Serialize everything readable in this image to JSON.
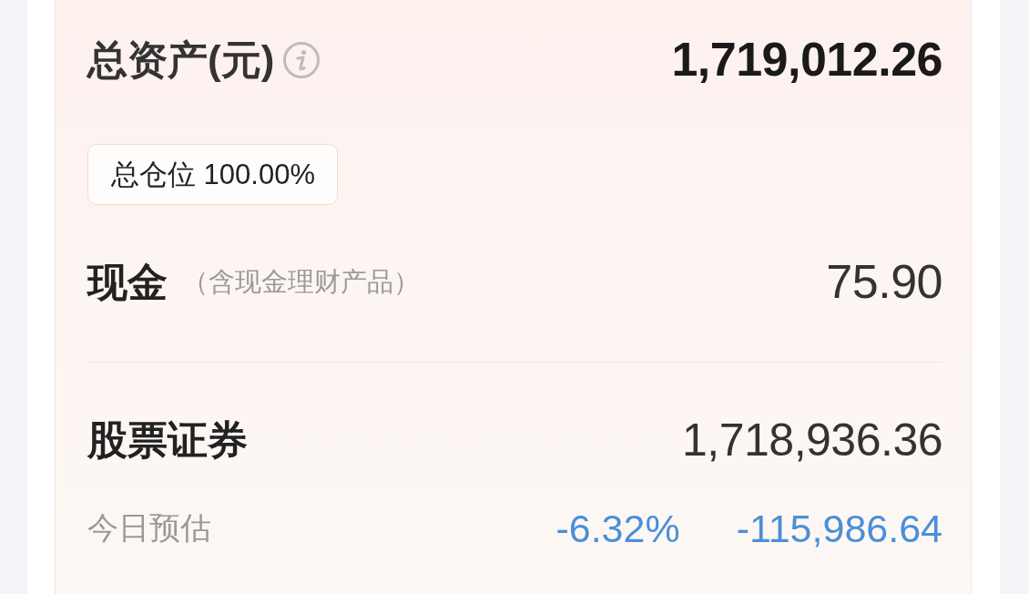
{
  "total_assets": {
    "label": "总资产(元)",
    "value": "1,719,012.26"
  },
  "position": {
    "label": "总仓位",
    "value": "100.00%"
  },
  "cash": {
    "label": "现金",
    "note": "（含现金理财产品）",
    "value": "75.90"
  },
  "securities": {
    "label": "股票证券",
    "value": "1,718,936.36"
  },
  "today_estimate": {
    "label": "今日预估",
    "percent": "-6.32%",
    "amount": "-115,986.64"
  }
}
